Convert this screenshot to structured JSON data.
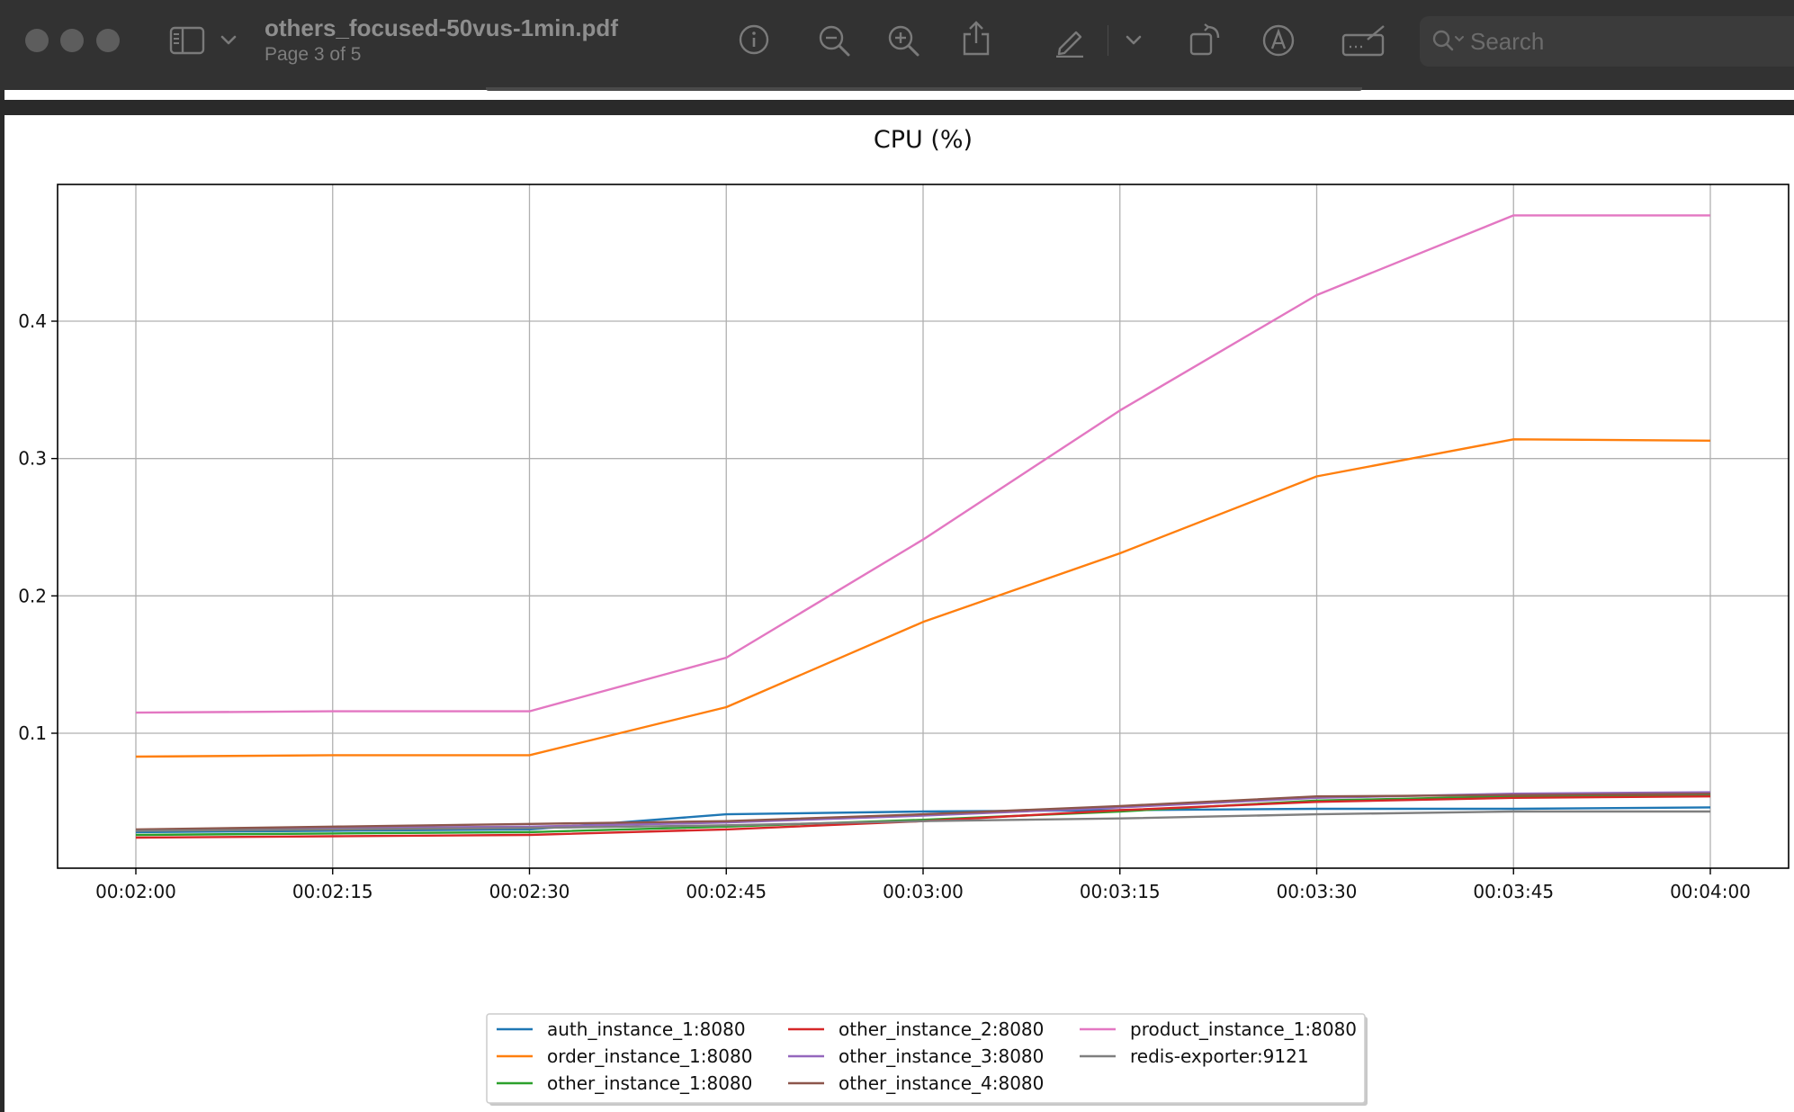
{
  "window": {
    "file_name": "others_focused-50vus-1min.pdf",
    "page_label": "Page 3 of 5"
  },
  "toolbar": {
    "icons": [
      "sidebar-icon",
      "chevron-down-icon",
      "info-icon",
      "zoom-out-icon",
      "zoom-in-icon",
      "share-icon",
      "markup-pen-icon",
      "chevron-down-icon",
      "rotate-icon",
      "annotate-icon",
      "signature-icon",
      "search-icon"
    ],
    "search_placeholder": "Search"
  },
  "colors": {
    "toolbar_bg": "#323232",
    "traffic_light": "#5d5d5d",
    "page_bg": "#ffffff"
  },
  "chart_data": {
    "type": "line",
    "title": "CPU (%)",
    "xlabel": "",
    "ylabel": "",
    "x": [
      "00:02:00",
      "00:02:15",
      "00:02:30",
      "00:02:45",
      "00:03:00",
      "00:03:15",
      "00:03:30",
      "00:03:45",
      "00:04:00"
    ],
    "y_ticks": [
      0.1,
      0.2,
      0.3,
      0.4
    ],
    "ylim": [
      0.0,
      0.5
    ],
    "grid": true,
    "legend_position": "bottom-center",
    "series": [
      {
        "name": "auth_instance_1:8080",
        "color": "#1f77b4",
        "values": [
          0.028,
          0.029,
          0.03,
          0.041,
          0.043,
          0.044,
          0.045,
          0.045,
          0.046
        ]
      },
      {
        "name": "order_instance_1:8080",
        "color": "#ff7f0e",
        "values": [
          0.083,
          0.084,
          0.084,
          0.119,
          0.181,
          0.231,
          0.287,
          0.314,
          0.313
        ]
      },
      {
        "name": "other_instance_1:8080",
        "color": "#2ca02c",
        "values": [
          0.026,
          0.027,
          0.028,
          0.032,
          0.037,
          0.043,
          0.051,
          0.054,
          0.055
        ]
      },
      {
        "name": "other_instance_2:8080",
        "color": "#d62728",
        "values": [
          0.024,
          0.025,
          0.026,
          0.03,
          0.036,
          0.044,
          0.05,
          0.053,
          0.054
        ]
      },
      {
        "name": "other_instance_3:8080",
        "color": "#9467bd",
        "values": [
          0.029,
          0.031,
          0.032,
          0.035,
          0.04,
          0.046,
          0.053,
          0.056,
          0.057
        ]
      },
      {
        "name": "other_instance_4:8080",
        "color": "#8c564b",
        "values": [
          0.03,
          0.032,
          0.034,
          0.036,
          0.041,
          0.047,
          0.054,
          0.055,
          0.056
        ]
      },
      {
        "name": "product_instance_1:8080",
        "color": "#e377c2",
        "values": [
          0.115,
          0.116,
          0.116,
          0.155,
          0.241,
          0.335,
          0.419,
          0.477,
          0.477
        ]
      },
      {
        "name": "redis-exporter:9121",
        "color": "#7f7f7f",
        "values": [
          0.029,
          0.03,
          0.031,
          0.033,
          0.036,
          0.038,
          0.041,
          0.043,
          0.043
        ]
      }
    ]
  }
}
